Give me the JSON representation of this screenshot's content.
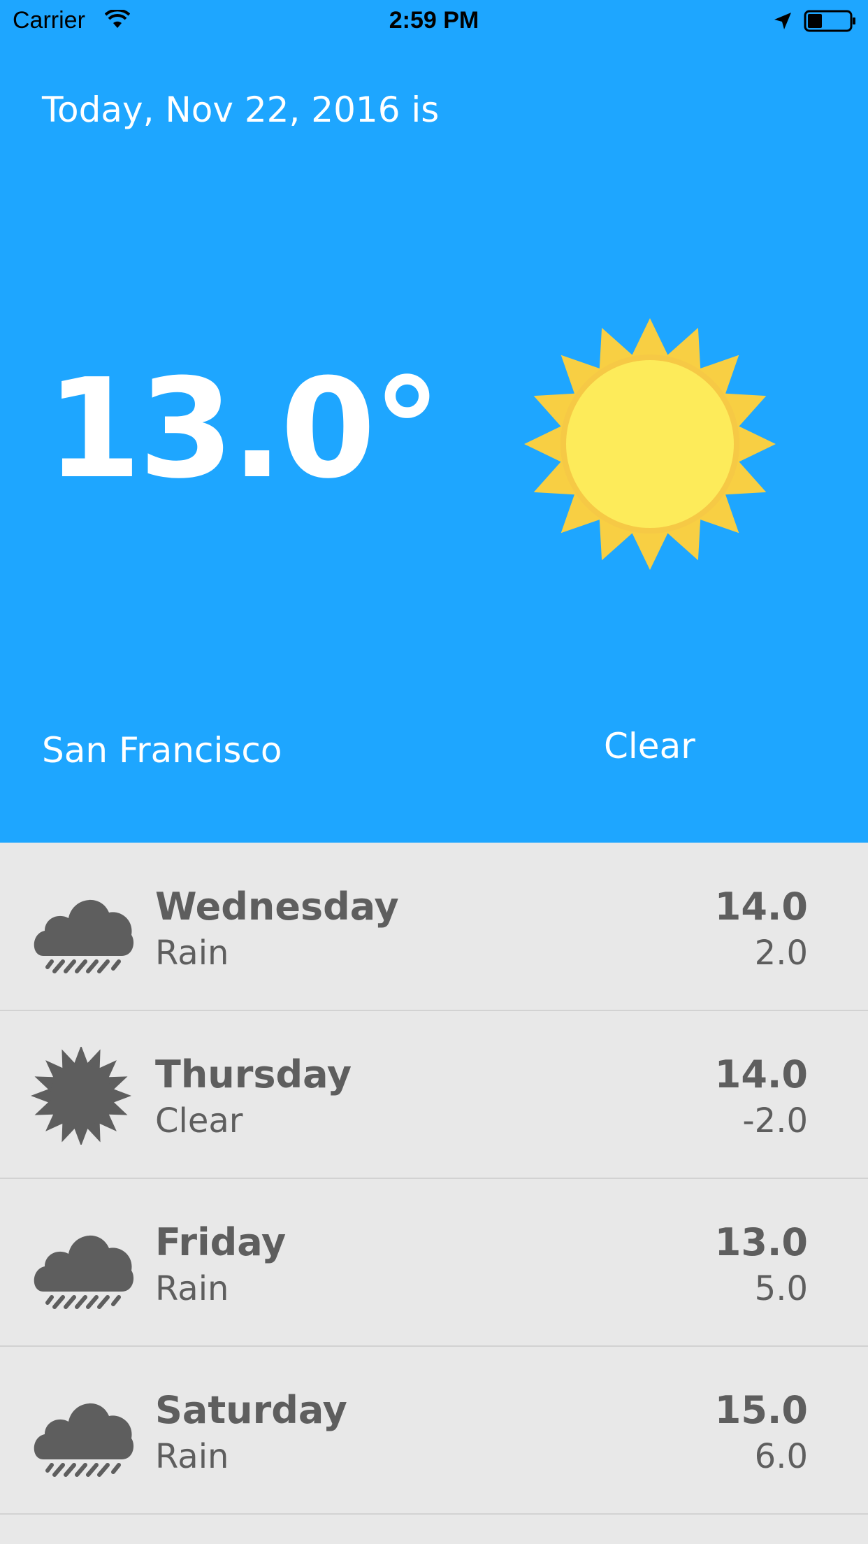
{
  "status_bar": {
    "carrier": "Carrier",
    "time": "2:59 PM"
  },
  "today": {
    "date_line": "Today, Nov 22, 2016 is",
    "temperature": "13.0°",
    "city": "San Francisco",
    "condition": "Clear",
    "icon": "sun-icon"
  },
  "colors": {
    "hero_bg": "#1ea6ff",
    "list_bg": "#e8e8e8",
    "list_text": "#5e5e5e",
    "sun_outer": "#f8cf43",
    "sun_inner": "#fdeb5a"
  },
  "forecast": [
    {
      "day": "Wednesday",
      "condition": "Rain",
      "high": "14.0",
      "low": "2.0",
      "icon": "rain-cloud-icon"
    },
    {
      "day": "Thursday",
      "condition": "Clear",
      "high": "14.0",
      "low": "-2.0",
      "icon": "sun-icon"
    },
    {
      "day": "Friday",
      "condition": "Rain",
      "high": "13.0",
      "low": "5.0",
      "icon": "rain-cloud-icon"
    },
    {
      "day": "Saturday",
      "condition": "Rain",
      "high": "15.0",
      "low": "6.0",
      "icon": "rain-cloud-icon"
    }
  ]
}
